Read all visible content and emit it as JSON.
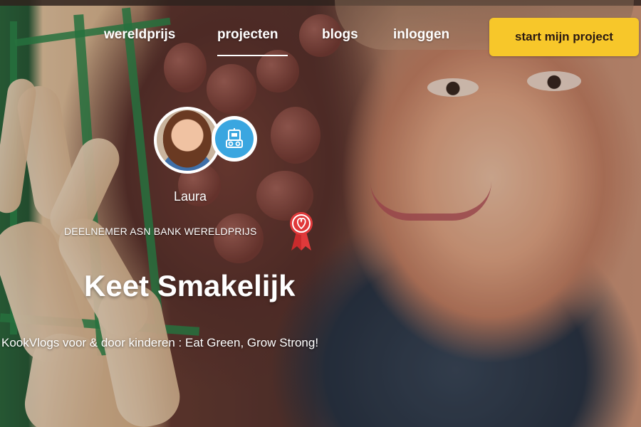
{
  "nav": {
    "links": [
      "wereldprijs",
      "projecten",
      "blogs",
      "inloggen"
    ],
    "active": "projecten",
    "cta_label": "start mijn project"
  },
  "profile": {
    "name": "Laura",
    "role_icon": "robot-icon",
    "badge_label": "DEELNEMER ASN BANK WERELDPRIJS",
    "badge_icon": "award-ribbon-icon"
  },
  "project": {
    "title": "Keet Smakelijk",
    "subtitle": "KookVlogs voor & door kinderen : Eat Green, Grow Strong!"
  },
  "colors": {
    "cta": "#f7c72a",
    "role_badge": "#3aa6e0",
    "ribbon": "#e0393a",
    "text": "#ffffff"
  }
}
